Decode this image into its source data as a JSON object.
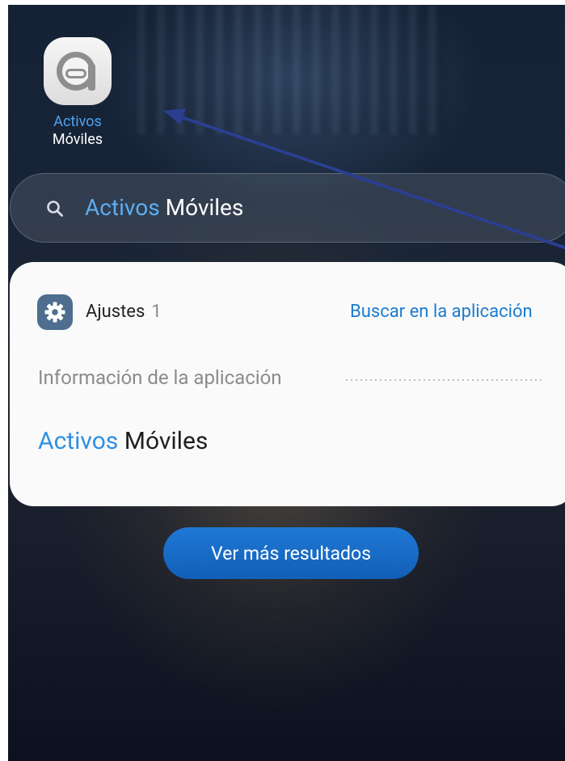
{
  "colors": {
    "highlight": "#2f8fe3",
    "link": "#1a7ccf",
    "button": "#1a6cc8",
    "card": "#fafafa"
  },
  "home": {
    "app": {
      "icon": "activos-moviles-app-icon",
      "label_highlight": "Activos",
      "label_rest": "Móviles"
    }
  },
  "search": {
    "icon": "search-icon",
    "query_highlight": "Activos",
    "query_rest": "Móviles"
  },
  "results": {
    "section": {
      "icon": "settings-gear-icon",
      "title": "Ajustes",
      "count": "1",
      "link": "Buscar en la aplicación"
    },
    "item": {
      "label": "Información de la aplicación",
      "name_highlight": "Activos",
      "name_rest": "Móviles"
    }
  },
  "more_button": {
    "label": "Ver más resultados"
  }
}
